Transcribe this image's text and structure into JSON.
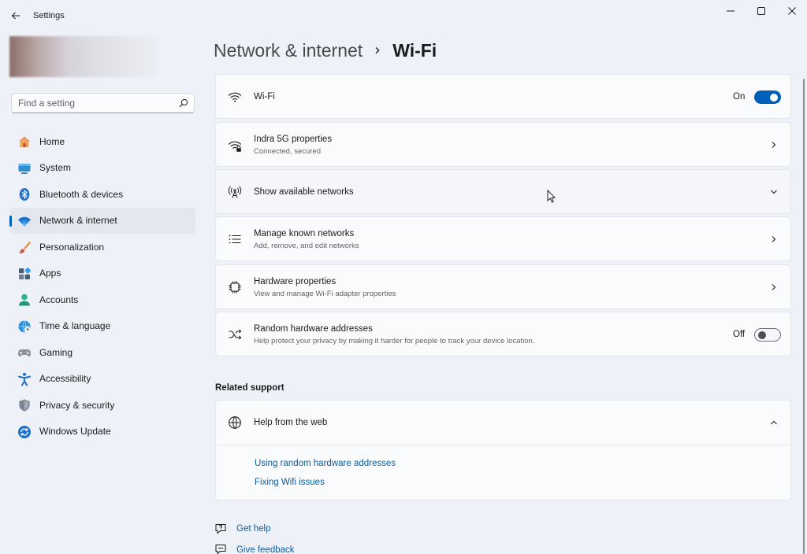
{
  "window": {
    "app_title": "Settings",
    "minimize_icon": "minimize-icon",
    "maximize_icon": "maximize-icon",
    "close_icon": "close-icon"
  },
  "search": {
    "placeholder": "Find a setting",
    "value": ""
  },
  "sidebar": {
    "items": [
      {
        "label": "Home",
        "icon": "home-icon",
        "active": false
      },
      {
        "label": "System",
        "icon": "system-icon",
        "active": false
      },
      {
        "label": "Bluetooth & devices",
        "icon": "bluetooth-icon",
        "active": false
      },
      {
        "label": "Network & internet",
        "icon": "network-icon",
        "active": true
      },
      {
        "label": "Personalization",
        "icon": "brush-icon",
        "active": false
      },
      {
        "label": "Apps",
        "icon": "apps-icon",
        "active": false
      },
      {
        "label": "Accounts",
        "icon": "accounts-icon",
        "active": false
      },
      {
        "label": "Time & language",
        "icon": "globe-clock-icon",
        "active": false
      },
      {
        "label": "Gaming",
        "icon": "gamepad-icon",
        "active": false
      },
      {
        "label": "Accessibility",
        "icon": "accessibility-icon",
        "active": false
      },
      {
        "label": "Privacy & security",
        "icon": "shield-icon",
        "active": false
      },
      {
        "label": "Windows Update",
        "icon": "update-icon",
        "active": false
      }
    ]
  },
  "breadcrumb": {
    "parent": "Network & internet",
    "current": "Wi-Fi"
  },
  "settings": {
    "wifi": {
      "title": "Wi-Fi",
      "toggle_label": "On",
      "toggle_on": true,
      "icon": "wifi-icon"
    },
    "properties": {
      "title": "Indra 5G properties",
      "subtitle": "Connected, secured",
      "icon": "wifi-lock-icon"
    },
    "available": {
      "title": "Show available networks",
      "icon": "antenna-icon"
    },
    "known": {
      "title": "Manage known networks",
      "subtitle": "Add, remove, and edit networks",
      "icon": "list-icon"
    },
    "hardware": {
      "title": "Hardware properties",
      "subtitle": "View and manage Wi-Fi adapter properties",
      "icon": "chip-icon"
    },
    "random": {
      "title": "Random hardware addresses",
      "subtitle": "Help protect your privacy by making it harder for people to track your device location.",
      "toggle_label": "Off",
      "toggle_on": false,
      "icon": "shuffle-icon"
    }
  },
  "related": {
    "heading": "Related support",
    "help_title": "Help from the web",
    "help_icon": "globe-icon",
    "links": [
      "Using random hardware addresses",
      "Fixing Wifi issues"
    ]
  },
  "footer": {
    "get_help": "Get help",
    "give_feedback": "Give feedback"
  },
  "colors": {
    "accent": "#005fb8",
    "link": "#0e5c9a",
    "background": "#eef1f8",
    "card": "#fafbfd"
  }
}
